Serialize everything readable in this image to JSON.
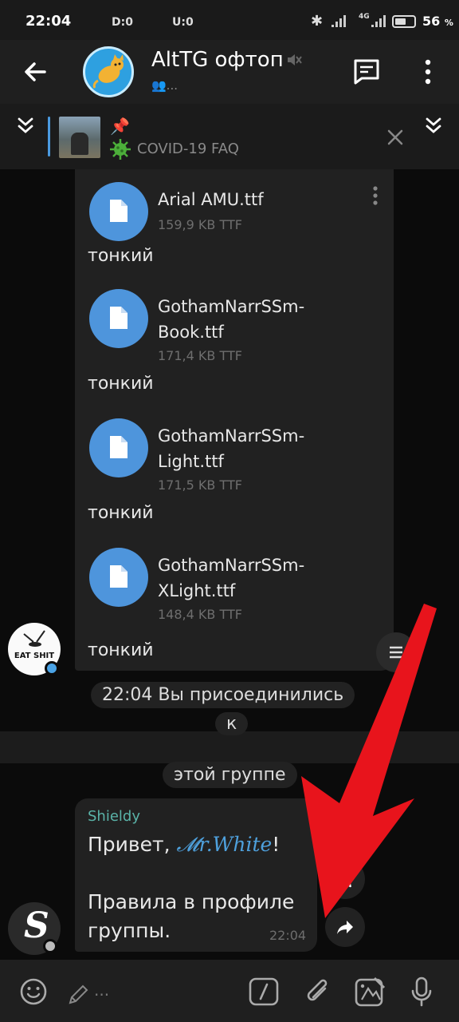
{
  "status_bar": {
    "time": "22:04",
    "d_label": "D:0",
    "u_label": "U:0",
    "network": "4G",
    "battery_percent": "56",
    "battery_unit": "%"
  },
  "header": {
    "title": "AltTG офтоп",
    "subtitle": "👥..."
  },
  "pinned": {
    "pin_emoji": "📌",
    "text": "COVID-19 FAQ"
  },
  "files": [
    {
      "name": "Arial AMU.ttf",
      "size": "159,9 KB TTF",
      "caption": "тонкий"
    },
    {
      "name": "GothamNarrSSm-Book.ttf",
      "size": "171,4 KB TTF",
      "caption": "тонкий"
    },
    {
      "name": "GothamNarrSSm-Light.ttf",
      "size": "171,5 KB TTF",
      "caption": "тонкий"
    },
    {
      "name": "GothamNarrSSm-XLight.ttf",
      "size": "148,4 KB TTF",
      "caption": "тонкий"
    }
  ],
  "service": {
    "line1": "22:04 Вы присоединились",
    "line2": "к",
    "line3": "этой группе"
  },
  "message": {
    "sender": "Shieldy",
    "greeting": "Привет, ",
    "mention": "𝓜r.White",
    "exclaim": "!",
    "body": "Правила в профиле группы.",
    "time": "22:04"
  },
  "sender_avatar_text": "EAT SHIT",
  "s_avatar_letter": "S",
  "input": {
    "placeholder": "..."
  },
  "colors": {
    "accent": "#4e95dc",
    "sender_name": "#5ab3a8",
    "arrow": "#e8141c"
  }
}
